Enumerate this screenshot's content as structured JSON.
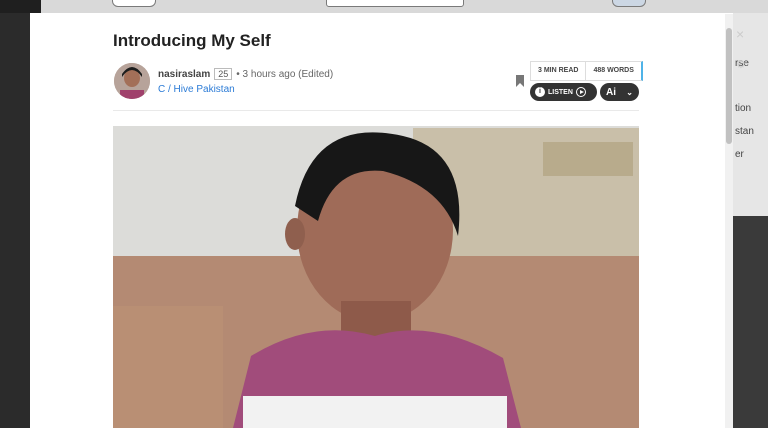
{
  "post": {
    "title": "Introducing My Self",
    "author": "nasiraslam",
    "reputation": "25",
    "time": "• 3 hours ago (Edited)",
    "community": "C / Hive Pakistan"
  },
  "stats": {
    "read_time": "3 MIN READ",
    "word_count": "488 WORDS"
  },
  "actions": {
    "listen_label": "LISTEN",
    "ai_label": "Ai"
  },
  "background": {
    "right_texts": [
      "rse",
      "tion",
      "stan",
      "er"
    ]
  }
}
